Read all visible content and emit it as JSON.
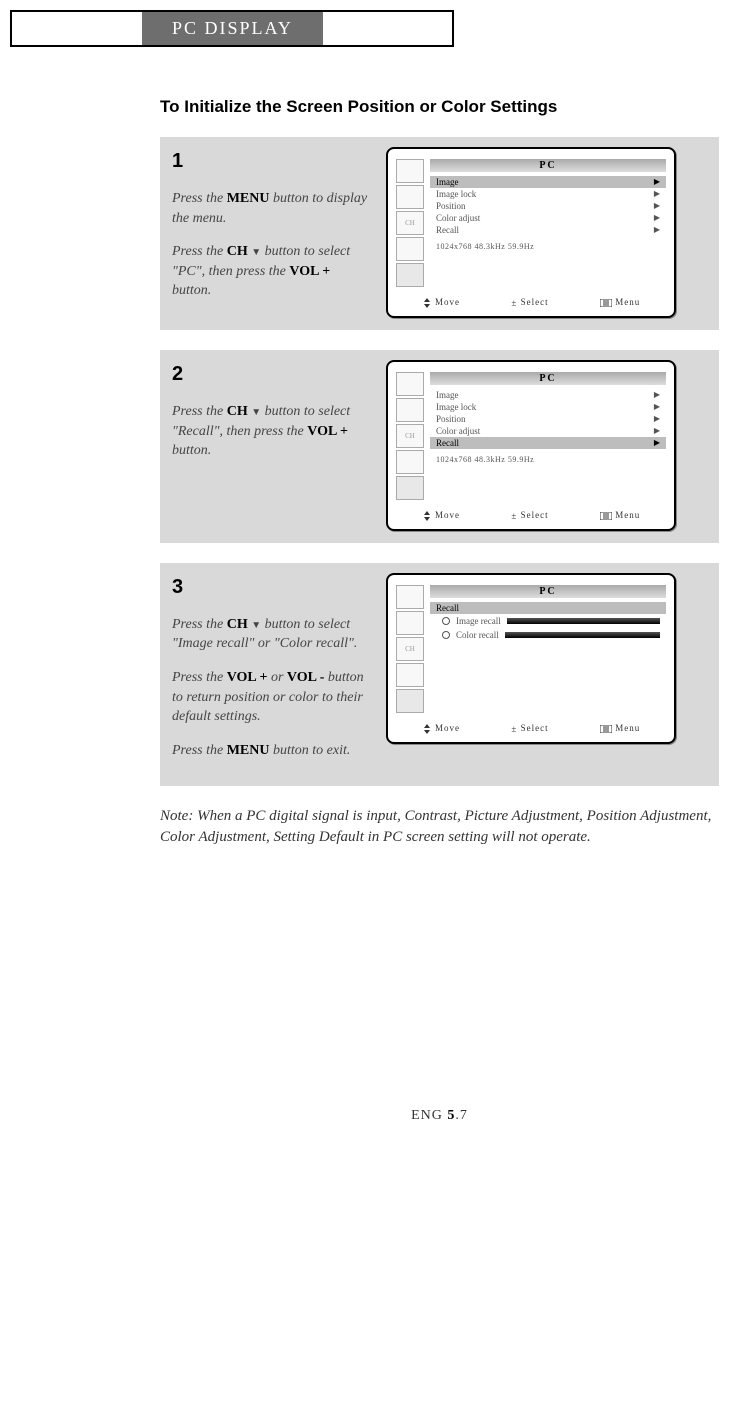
{
  "header": {
    "tab": "PC DISPLAY"
  },
  "section_title": "To Initialize the Screen Position or Color Settings",
  "steps": [
    {
      "num": "1",
      "paras": [
        "Press the <b>MENU</b> button to display the menu.",
        "Press the <b>CH</b> <span class='tri-down'></span> button to select \"PC\", then press the <b>VOL +</b> button."
      ],
      "osd": {
        "title": "PC",
        "items": [
          {
            "label": "Image",
            "hl": true
          },
          {
            "label": "Image lock",
            "hl": false
          },
          {
            "label": "Position",
            "hl": false
          },
          {
            "label": "Color adjust",
            "hl": false
          },
          {
            "label": "Recall",
            "hl": false
          }
        ],
        "resolution": "1024x768  48.3kHz 59.9Hz",
        "bottom": {
          "move": "Move",
          "select": "Select",
          "menu": "Menu"
        }
      }
    },
    {
      "num": "2",
      "paras": [
        "Press the <b>CH</b> <span class='tri-down'></span> button to select \"Recall\",  then press the <b>VOL +</b> button."
      ],
      "osd": {
        "title": "PC",
        "items": [
          {
            "label": "Image",
            "hl": false
          },
          {
            "label": "Image lock",
            "hl": false
          },
          {
            "label": "Position",
            "hl": false
          },
          {
            "label": "Color adjust",
            "hl": false
          },
          {
            "label": "Recall",
            "hl": true
          }
        ],
        "resolution": "1024x768  48.3kHz 59.9Hz",
        "bottom": {
          "move": "Move",
          "select": "Select",
          "menu": "Menu"
        }
      }
    },
    {
      "num": "3",
      "paras": [
        "Press the <b>CH</b> <span class='tri-down'></span> button to select \"Image recall\" or \"Color recall\".",
        "Press the <b>VOL +</b> or  <b>VOL -</b> button to return position or color to their default settings.",
        "Press the <b>MENU</b> button to exit."
      ],
      "osd_recall": {
        "title": "PC",
        "header": "Recall",
        "items": [
          {
            "label": "Image recall"
          },
          {
            "label": "Color recall"
          }
        ],
        "bottom": {
          "move": "Move",
          "select": "Select",
          "menu": "Menu"
        }
      }
    }
  ],
  "note": "Note: When a PC digital signal is input, Contrast, Picture Adjustment, Position Adjustment, Color Adjustment, Setting Default in PC screen setting will not operate.",
  "footer": {
    "pre": "ENG ",
    "mid": "5",
    "post": ".7"
  }
}
